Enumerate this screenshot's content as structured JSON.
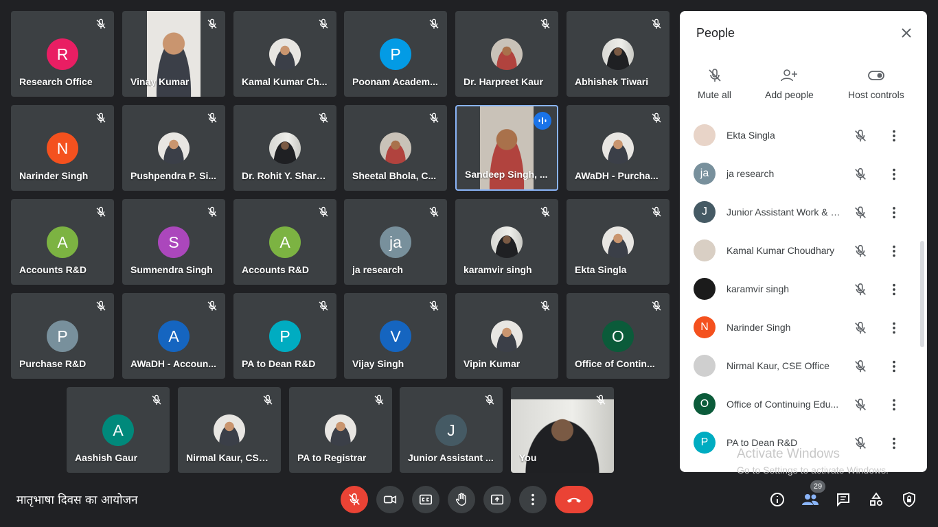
{
  "tiles": [
    {
      "name": "Research Office",
      "initial": "R",
      "color": "#e91e63",
      "type": "avatar"
    },
    {
      "name": "Vinay Kumar",
      "type": "video",
      "photo": "photo-a"
    },
    {
      "name": "Kamal Kumar Ch...",
      "type": "photo",
      "photo": "photo-a"
    },
    {
      "name": "Poonam Academ...",
      "initial": "P",
      "color": "#039be5",
      "type": "avatar"
    },
    {
      "name": "Dr. Harpreet Kaur",
      "type": "photo",
      "photo": "photo-b"
    },
    {
      "name": "Abhishek Tiwari",
      "type": "photo",
      "photo": "photo-c"
    },
    {
      "name": "Narinder Singh",
      "initial": "N",
      "color": "#f4511e",
      "type": "avatar"
    },
    {
      "name": "Pushpendra P. Si...",
      "type": "photo",
      "photo": "photo-a"
    },
    {
      "name": "Dr. Rohit Y. Sharma",
      "type": "photo",
      "photo": "photo-c"
    },
    {
      "name": "Sheetal Bhola, C...",
      "type": "photo",
      "photo": "photo-b"
    },
    {
      "name": "Sandeep Singh, ...",
      "type": "video",
      "photo": "photo-b",
      "speaking": true
    },
    {
      "name": "AWaDH - Purcha...",
      "type": "photo",
      "photo": "photo-a"
    },
    {
      "name": "Accounts R&D",
      "initial": "A",
      "color": "#7cb342",
      "type": "avatar"
    },
    {
      "name": "Sumnendra Singh",
      "initial": "S",
      "color": "#ab47bc",
      "type": "avatar"
    },
    {
      "name": "Accounts R&D",
      "initial": "A",
      "color": "#7cb342",
      "type": "avatar"
    },
    {
      "name": "ja research",
      "initial": "ja",
      "color": "#78909c",
      "type": "avatar"
    },
    {
      "name": "karamvir singh",
      "type": "photo",
      "photo": "photo-c"
    },
    {
      "name": "Ekta Singla",
      "type": "photo",
      "photo": "photo-a"
    },
    {
      "name": "Purchase R&D",
      "initial": "P",
      "color": "#78909c",
      "type": "avatar"
    },
    {
      "name": "AWaDH - Accoun...",
      "initial": "A",
      "color": "#1565c0",
      "type": "avatar"
    },
    {
      "name": "PA to Dean R&D",
      "initial": "P",
      "color": "#00acc1",
      "type": "avatar"
    },
    {
      "name": "Vijay Singh",
      "initial": "V",
      "color": "#1565c0",
      "type": "avatar"
    },
    {
      "name": "Vipin Kumar",
      "type": "photo",
      "photo": "photo-a"
    },
    {
      "name": "Office of Contin...",
      "initial": "O",
      "color": "#0b5b3a",
      "type": "avatar"
    },
    {
      "name": "Aashish Gaur",
      "initial": "A",
      "color": "#00897b",
      "type": "avatar"
    },
    {
      "name": "Nirmal Kaur, CSE ...",
      "type": "photo",
      "photo": "photo-a"
    },
    {
      "name": "PA to Registrar",
      "type": "photo",
      "photo": "photo-a"
    },
    {
      "name": "Junior Assistant ...",
      "initial": "J",
      "color": "#455a64",
      "type": "avatar"
    },
    {
      "name": "You",
      "type": "self",
      "photo": "photo-c"
    }
  ],
  "panel": {
    "title": "People",
    "actions": {
      "mute_all": "Mute all",
      "add_people": "Add people",
      "host_controls": "Host controls"
    },
    "people": [
      {
        "name": "Ekta Singla",
        "initial": "",
        "color": "#e8d4c8"
      },
      {
        "name": "ja research",
        "initial": "ja",
        "color": "#78909c"
      },
      {
        "name": "Junior Assistant Work & E...",
        "initial": "J",
        "color": "#455a64"
      },
      {
        "name": "Kamal Kumar Choudhary",
        "initial": "",
        "color": "#d9cfc4"
      },
      {
        "name": "karamvir singh",
        "initial": "",
        "color": "#1b1b1b"
      },
      {
        "name": "Narinder Singh",
        "initial": "N",
        "color": "#f4511e"
      },
      {
        "name": "Nirmal Kaur, CSE Office",
        "initial": "",
        "color": "#cfcfcf"
      },
      {
        "name": "Office of Continuing Edu...",
        "initial": "O",
        "color": "#0b5b3a"
      },
      {
        "name": "PA to Dean R&D",
        "initial": "P",
        "color": "#00acc1"
      }
    ]
  },
  "watermark": {
    "line1": "Activate Windows",
    "line2": "Go to Settings to activate Windows."
  },
  "meeting_title": "मातृभाषा दिवस का आयोजन",
  "participant_count": "29"
}
